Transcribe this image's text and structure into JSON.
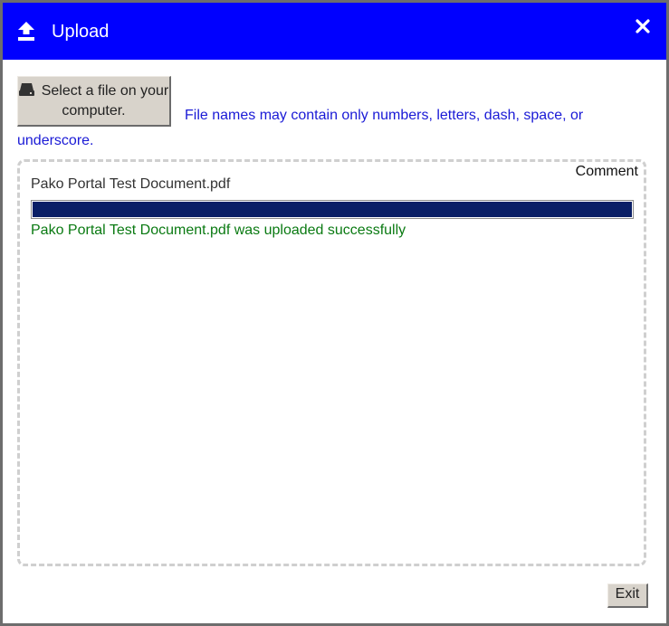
{
  "window": {
    "title": "Upload",
    "title_icon": "upload-icon",
    "close_icon": "close-icon",
    "title_bar_color": "#0000ff"
  },
  "select_button": {
    "icon": "hard-drive-icon",
    "label": "Select a file on your computer."
  },
  "hint": "File names may contain only numbers, letters, dash, space, or underscore.",
  "dropzone": {
    "comment_label": "Comment",
    "file": {
      "name": "Pako Portal Test Document.pdf",
      "progress_percent": 100,
      "progress_color": "#0a1f66",
      "status_message": "Pako Portal Test Document.pdf was uploaded successfully",
      "status_color": "#0a7a12"
    }
  },
  "exit_button": {
    "label": "Exit"
  }
}
